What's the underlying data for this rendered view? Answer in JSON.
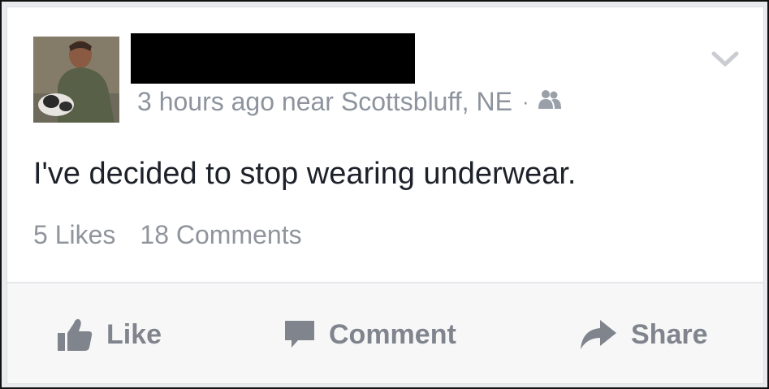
{
  "post": {
    "author_name": "",
    "meta_text": "3 hours ago near Scottsbluff, NE",
    "separator": "·",
    "audience_icon": "friends-icon",
    "menu_icon": "chevron-down-icon",
    "body_text": "I've decided to stop wearing underwear.",
    "likes_text": "5 Likes",
    "comments_text": "18 Comments"
  },
  "actions": {
    "like": {
      "label": "Like",
      "icon": "thumbs-up-icon"
    },
    "comment": {
      "label": "Comment",
      "icon": "speech-bubble-icon"
    },
    "share": {
      "label": "Share",
      "icon": "share-arrow-icon"
    }
  },
  "colors": {
    "text_primary": "#1d2129",
    "text_muted": "#8d949e",
    "action_gray": "#7f848d",
    "action_bar_bg": "#f7f7f8"
  }
}
